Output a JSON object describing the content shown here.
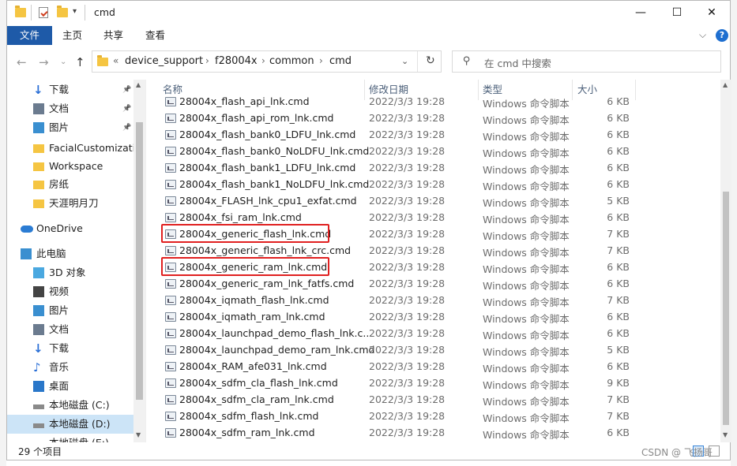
{
  "window": {
    "title": "cmd"
  },
  "controls": {
    "minimize": "—",
    "maximize": "☐",
    "close": "✕",
    "collapse": "⌵",
    "help": "?"
  },
  "ribbon": {
    "tabs": [
      "文件",
      "主页",
      "共享",
      "查看"
    ]
  },
  "address": {
    "prefix": "«",
    "crumbs": [
      "device_support",
      "f28004x",
      "common",
      "cmd"
    ]
  },
  "search": {
    "placeholder": "在 cmd 中搜索"
  },
  "nav": {
    "items": [
      {
        "label": "下载",
        "icon": "download-icon",
        "pinned": true
      },
      {
        "label": "文档",
        "icon": "document-icon",
        "pinned": true
      },
      {
        "label": "图片",
        "icon": "picture-icon",
        "pinned": true
      },
      {
        "label": "FacialCustomizatio",
        "icon": "folder-icon"
      },
      {
        "label": "Workspace",
        "icon": "folder-icon"
      },
      {
        "label": "房纸",
        "icon": "folder-icon"
      },
      {
        "label": "天涯明月刀",
        "icon": "folder-icon"
      },
      {
        "label": "OneDrive",
        "icon": "cloud-icon"
      },
      {
        "label": "此电脑",
        "icon": "computer-icon"
      },
      {
        "label": "3D 对象",
        "icon": "cube-icon"
      },
      {
        "label": "视频",
        "icon": "video-icon"
      },
      {
        "label": "图片",
        "icon": "picture-icon"
      },
      {
        "label": "文档",
        "icon": "document-icon"
      },
      {
        "label": "下载",
        "icon": "download-icon"
      },
      {
        "label": "音乐",
        "icon": "music-icon"
      },
      {
        "label": "桌面",
        "icon": "desktop-icon"
      },
      {
        "label": "本地磁盘 (C:)",
        "icon": "drive-icon"
      },
      {
        "label": "本地磁盘 (D:)",
        "icon": "drive-icon",
        "selected": true
      },
      {
        "label": "本地磁盘 (E:)",
        "icon": "drive-icon"
      }
    ]
  },
  "columns": {
    "name": "名称",
    "date": "修改日期",
    "type": "类型",
    "size": "大小"
  },
  "files": [
    {
      "name": "28004x_flash_api_lnk.cmd",
      "date": "2022/3/3 19:28",
      "type": "Windows 命令脚本",
      "size": "6 KB"
    },
    {
      "name": "28004x_flash_api_rom_lnk.cmd",
      "date": "2022/3/3 19:28",
      "type": "Windows 命令脚本",
      "size": "6 KB"
    },
    {
      "name": "28004x_flash_bank0_LDFU_lnk.cmd",
      "date": "2022/3/3 19:28",
      "type": "Windows 命令脚本",
      "size": "6 KB"
    },
    {
      "name": "28004x_flash_bank0_NoLDFU_lnk.cmd",
      "date": "2022/3/3 19:28",
      "type": "Windows 命令脚本",
      "size": "6 KB"
    },
    {
      "name": "28004x_flash_bank1_LDFU_lnk.cmd",
      "date": "2022/3/3 19:28",
      "type": "Windows 命令脚本",
      "size": "6 KB"
    },
    {
      "name": "28004x_flash_bank1_NoLDFU_lnk.cmd",
      "date": "2022/3/3 19:28",
      "type": "Windows 命令脚本",
      "size": "6 KB"
    },
    {
      "name": "28004x_FLASH_lnk_cpu1_exfat.cmd",
      "date": "2022/3/3 19:28",
      "type": "Windows 命令脚本",
      "size": "5 KB"
    },
    {
      "name": "28004x_fsi_ram_lnk.cmd",
      "date": "2022/3/3 19:28",
      "type": "Windows 命令脚本",
      "size": "6 KB"
    },
    {
      "name": "28004x_generic_flash_lnk.cmd",
      "date": "2022/3/3 19:28",
      "type": "Windows 命令脚本",
      "size": "7 KB",
      "highlight": true
    },
    {
      "name": "28004x_generic_flash_lnk_crc.cmd",
      "date": "2022/3/3 19:28",
      "type": "Windows 命令脚本",
      "size": "7 KB"
    },
    {
      "name": "28004x_generic_ram_lnk.cmd",
      "date": "2022/3/3 19:28",
      "type": "Windows 命令脚本",
      "size": "6 KB",
      "highlight": true
    },
    {
      "name": "28004x_generic_ram_lnk_fatfs.cmd",
      "date": "2022/3/3 19:28",
      "type": "Windows 命令脚本",
      "size": "6 KB"
    },
    {
      "name": "28004x_iqmath_flash_lnk.cmd",
      "date": "2022/3/3 19:28",
      "type": "Windows 命令脚本",
      "size": "7 KB"
    },
    {
      "name": "28004x_iqmath_ram_lnk.cmd",
      "date": "2022/3/3 19:28",
      "type": "Windows 命令脚本",
      "size": "6 KB"
    },
    {
      "name": "28004x_launchpad_demo_flash_lnk.c...",
      "date": "2022/3/3 19:28",
      "type": "Windows 命令脚本",
      "size": "6 KB"
    },
    {
      "name": "28004x_launchpad_demo_ram_lnk.cmd",
      "date": "2022/3/3 19:28",
      "type": "Windows 命令脚本",
      "size": "5 KB"
    },
    {
      "name": "28004x_RAM_afe031_lnk.cmd",
      "date": "2022/3/3 19:28",
      "type": "Windows 命令脚本",
      "size": "6 KB"
    },
    {
      "name": "28004x_sdfm_cla_flash_lnk.cmd",
      "date": "2022/3/3 19:28",
      "type": "Windows 命令脚本",
      "size": "9 KB"
    },
    {
      "name": "28004x_sdfm_cla_ram_lnk.cmd",
      "date": "2022/3/3 19:28",
      "type": "Windows 命令脚本",
      "size": "7 KB"
    },
    {
      "name": "28004x_sdfm_flash_lnk.cmd",
      "date": "2022/3/3 19:28",
      "type": "Windows 命令脚本",
      "size": "7 KB"
    },
    {
      "name": "28004x_sdfm_ram_lnk.cmd",
      "date": "2022/3/3 19:28",
      "type": "Windows 命令脚本",
      "size": "6 KB"
    }
  ],
  "status": {
    "count": "29 个项目"
  },
  "watermark": "CSDN @ 飞扬哥",
  "colors": {
    "accent": "#1e5aa8",
    "highlight_box": "#e02020",
    "folder": "#f5c542"
  }
}
